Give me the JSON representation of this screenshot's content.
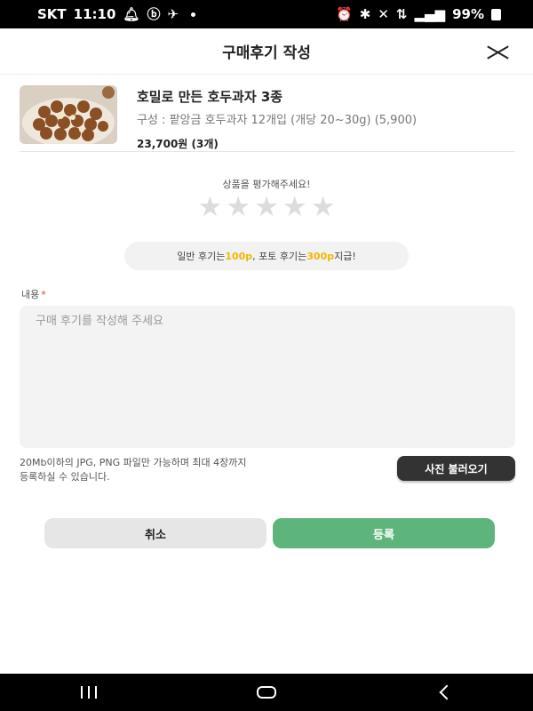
{
  "status_bar": {
    "carrier": "SKT",
    "time": "11:10",
    "battery": "99%"
  },
  "header": {
    "title": "구매후기 작성"
  },
  "product": {
    "name": "호밀로 만든 호두과자 3종",
    "option": "구성 : 팥앙금 호두과자 12개입 (개당 20~30g) (5,900)",
    "price": "23,700원 (3개)"
  },
  "rating": {
    "prompt": "상품을 평가해주세요!",
    "max_stars": 5,
    "selected": 0,
    "star_color": "#dcdcdc"
  },
  "points": {
    "text_1": "일반 후기는 ",
    "general_points": "100p",
    "text_2": ", 포토 후기는 ",
    "photo_points": "300p",
    "text_3": " 지급!",
    "highlight_color": "#f2b705"
  },
  "content": {
    "label": "내용",
    "required_mark": "*",
    "placeholder": "구매 후기를 작성해 주세요",
    "value": ""
  },
  "upload": {
    "note_line1": "20Mb이하의 JPG, PNG 파일만 가능하며 최대 4장까지",
    "note_line2": "등록하실 수 있습니다.",
    "button_label": "사진 불러오기"
  },
  "actions": {
    "cancel_label": "취소",
    "submit_label": "등록",
    "submit_color": "#5db57b"
  }
}
